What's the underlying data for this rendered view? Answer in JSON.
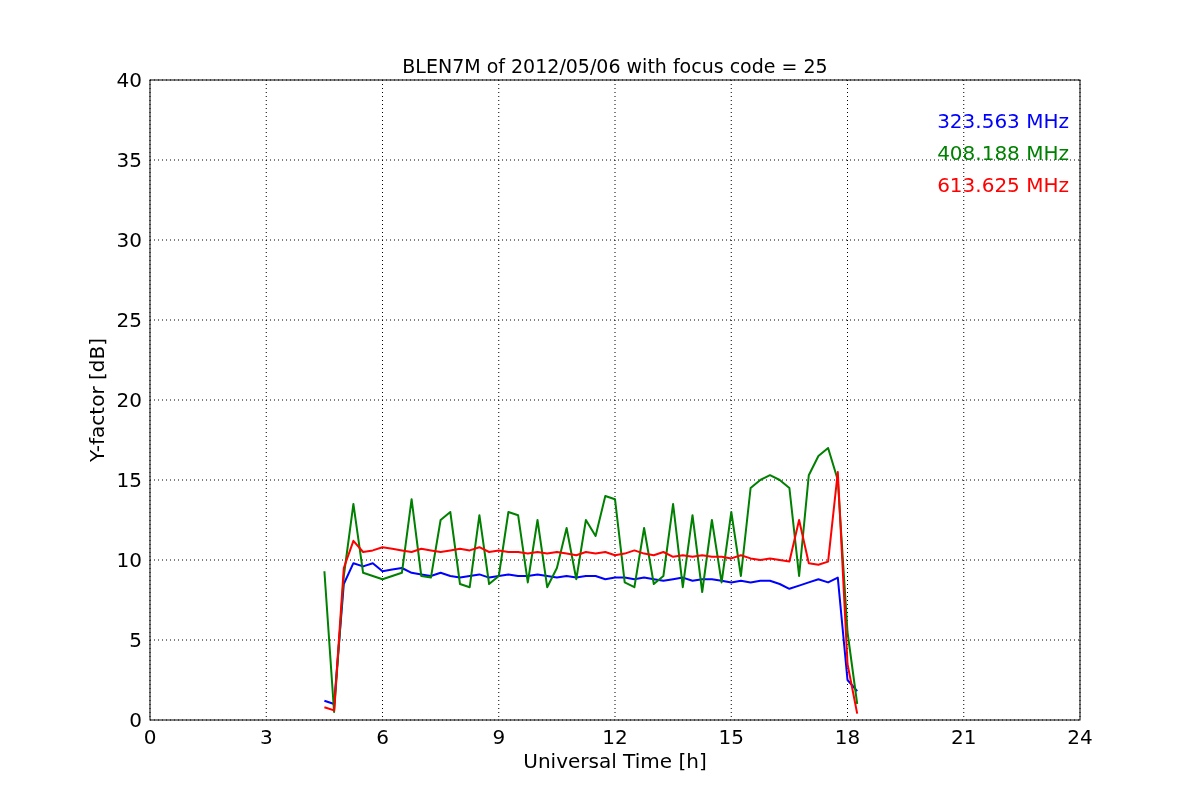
{
  "chart_data": {
    "type": "line",
    "title": "BLEN7M of 2012/05/06 with focus code = 25",
    "xlabel": "Universal Time [h]",
    "ylabel": "Y-factor [dB]",
    "x": [
      4.5,
      4.75,
      5,
      5.25,
      5.5,
      5.75,
      6,
      6.25,
      6.5,
      6.75,
      7,
      7.25,
      7.5,
      7.75,
      8,
      8.25,
      8.5,
      8.75,
      9,
      9.25,
      9.5,
      9.75,
      10,
      10.25,
      10.5,
      10.75,
      11,
      11.25,
      11.5,
      11.75,
      12,
      12.25,
      12.5,
      12.75,
      13,
      13.25,
      13.5,
      13.75,
      14,
      14.25,
      14.5,
      14.75,
      15,
      15.25,
      15.5,
      15.75,
      16,
      16.25,
      16.5,
      16.75,
      17,
      17.25,
      17.5,
      17.75,
      18,
      18.25
    ],
    "series": [
      {
        "name": "323.563 MHz",
        "color": "#0000ff",
        "values": [
          1.2,
          1.0,
          8.5,
          9.8,
          9.6,
          9.8,
          9.3,
          9.4,
          9.5,
          9.2,
          9.1,
          9.0,
          9.2,
          9.0,
          8.9,
          9.0,
          9.1,
          8.9,
          9.0,
          9.1,
          9.0,
          9.0,
          9.1,
          9.0,
          8.9,
          9.0,
          8.9,
          9.0,
          9.0,
          8.8,
          8.9,
          8.9,
          8.8,
          8.9,
          8.8,
          8.7,
          8.8,
          8.9,
          8.7,
          8.8,
          8.8,
          8.7,
          8.6,
          8.7,
          8.6,
          8.7,
          8.7,
          8.5,
          8.2,
          8.4,
          8.6,
          8.8,
          8.6,
          8.9,
          2.5,
          1.8
        ]
      },
      {
        "name": "408.188 MHz",
        "color": "#008000",
        "values": [
          9.3,
          0.5,
          9.0,
          13.5,
          9.2,
          9.0,
          8.8,
          9.0,
          9.2,
          13.8,
          9.0,
          8.9,
          12.5,
          13.0,
          8.5,
          8.3,
          12.8,
          8.5,
          9.0,
          13.0,
          12.8,
          8.6,
          12.5,
          8.3,
          9.5,
          12.0,
          8.8,
          12.5,
          11.5,
          14.0,
          13.8,
          8.6,
          8.3,
          12.0,
          8.5,
          9.0,
          13.5,
          8.3,
          12.8,
          8.0,
          12.5,
          8.6,
          13.0,
          9.0,
          14.5,
          15.0,
          15.3,
          15.0,
          14.5,
          9.0,
          15.3,
          16.5,
          17.0,
          15.0,
          5.5,
          1.0
        ]
      },
      {
        "name": "613.625 MHz",
        "color": "#ff0000",
        "values": [
          0.8,
          0.6,
          9.5,
          11.2,
          10.5,
          10.6,
          10.8,
          10.7,
          10.6,
          10.5,
          10.7,
          10.6,
          10.5,
          10.6,
          10.7,
          10.6,
          10.8,
          10.5,
          10.6,
          10.5,
          10.5,
          10.4,
          10.5,
          10.4,
          10.5,
          10.4,
          10.3,
          10.5,
          10.4,
          10.5,
          10.3,
          10.4,
          10.6,
          10.4,
          10.3,
          10.5,
          10.2,
          10.3,
          10.2,
          10.3,
          10.2,
          10.2,
          10.1,
          10.3,
          10.1,
          10.0,
          10.1,
          10.0,
          9.9,
          12.5,
          9.8,
          9.7,
          9.9,
          15.5,
          3.5,
          0.4
        ]
      }
    ],
    "xlim": [
      0,
      24
    ],
    "ylim": [
      0,
      40
    ],
    "grid": true,
    "xticks": [
      0,
      3,
      6,
      9,
      12,
      15,
      18,
      21,
      24
    ],
    "yticks": [
      0,
      5,
      10,
      15,
      20,
      25,
      30,
      35,
      40
    ]
  }
}
